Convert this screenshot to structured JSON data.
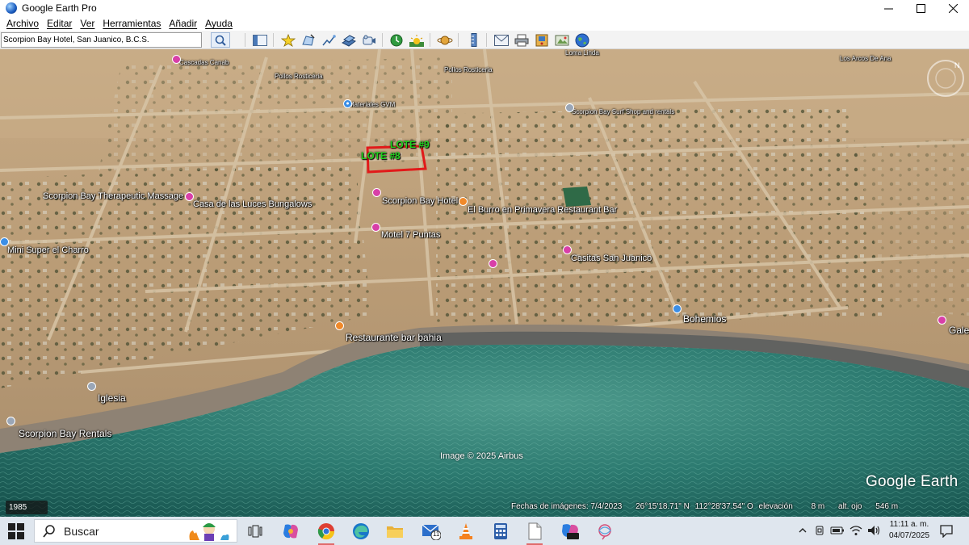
{
  "window": {
    "title": "Google Earth Pro",
    "controls": [
      "minimize",
      "maximize",
      "close"
    ]
  },
  "menu": {
    "items": [
      "Archivo",
      "Editar",
      "Ver",
      "Herramientas",
      "Añadir",
      "Ayuda"
    ]
  },
  "search": {
    "value": "Scorpion Bay Hotel, San Juanico, B.C.S."
  },
  "toolbar": {
    "icons": [
      "sidebar-icon",
      "placemark-icon",
      "polygon-icon",
      "path-icon",
      "image-overlay-icon",
      "record-tour-icon",
      "historical-imagery-icon",
      "sunlight-icon",
      "planets-icon",
      "ruler-icon",
      "email-icon",
      "print-icon",
      "save-image-icon",
      "view-in-maps-icon",
      "earth-icon"
    ]
  },
  "map": {
    "labels": {
      "lote9": "LOTE #9",
      "lote8": "LOTE #8",
      "scorpion_bay_massage": "Scorpion Bay Therapeutic Massage",
      "casa_luces": "Casa de las Luces Bungalows",
      "scorpion_bay_hotel": "Scorpion Bay Hotel",
      "el_burro": "El Burro en Primavera Restaurant Bar",
      "motel_7": "Motel 7 Puntas",
      "mini_super": "Mini Super el Charro",
      "casitas": "Casitas San Juanico",
      "bohemios": "Bohemios",
      "restaurante_bahia": "Restaurante bar bahia",
      "iglesia": "Iglesia",
      "scorpion_rentals": "Scorpion Bay Rentals",
      "gale": "Gale",
      "materiales": "Materiales GVM",
      "surfshop": "Scorpion Bay Surf Shop and rentals",
      "small1": "Cascadas Canab",
      "small2": "Pollos Rosticeria",
      "small3": "Pollos Rosticeria",
      "small4": "Loma Linda",
      "small5": "Los Arcos De Ana",
      "small6": "Taller Santa"
    },
    "image_credit": "Image © 2025 Airbus",
    "watermark": "Google Earth",
    "history_year": "1985",
    "status": {
      "imagery_date": "Fechas de imágenes: 7/4/2023",
      "lat": "26°15'18.71\" N",
      "lon": "112°28'37.54\" O",
      "elevation": "elevación",
      "elevation_value": "8 m",
      "eye_alt": "alt. ojo",
      "eye_alt_value": "546 m"
    }
  },
  "taskbar": {
    "search_placeholder": "Buscar",
    "mail_badge": "11",
    "clock_time": "11:11 a. m.",
    "clock_date": "04/07/2025"
  },
  "colors": {
    "sea": "#2f7b72",
    "land": "#bda07c",
    "lote_outline": "#e11a1a",
    "lote_label": "#1ed31e"
  }
}
